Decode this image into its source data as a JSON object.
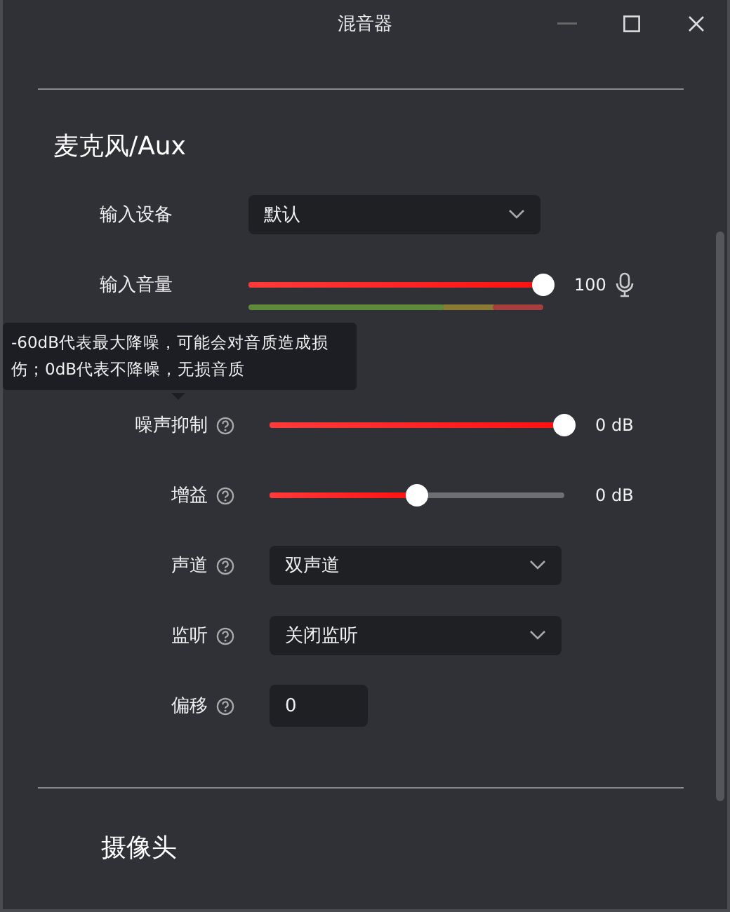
{
  "window": {
    "title": "混音器"
  },
  "sections": [
    {
      "title": "麦克风/Aux",
      "rows": [
        {
          "kind": "select",
          "label": "输入设备",
          "help": false,
          "value": "默认"
        },
        {
          "kind": "slider",
          "label": "输入音量",
          "help": false,
          "level": 1,
          "reading": "100",
          "mic": true,
          "meter": true
        },
        {
          "kind": "hidden"
        },
        {
          "kind": "slider",
          "label": "噪声抑制",
          "help": true,
          "level": 1,
          "reading": "0 dB",
          "mic": false,
          "meter": false
        },
        {
          "kind": "slider",
          "label": "增益",
          "help": true,
          "level": 0.5,
          "reading": "0 dB",
          "mic": false,
          "meter": false
        },
        {
          "kind": "select",
          "label": "声道",
          "help": true,
          "value": "双声道"
        },
        {
          "kind": "select",
          "label": "监听",
          "help": true,
          "value": "关闭监听"
        },
        {
          "kind": "input",
          "label": "偏移",
          "help": true,
          "value": "0"
        }
      ]
    },
    {
      "title": "摄像头"
    }
  ],
  "tooltip": {
    "text": "-60dB代表最大降噪，可能会对音质造成损伤；0dB代表不降噪，无损音质"
  }
}
